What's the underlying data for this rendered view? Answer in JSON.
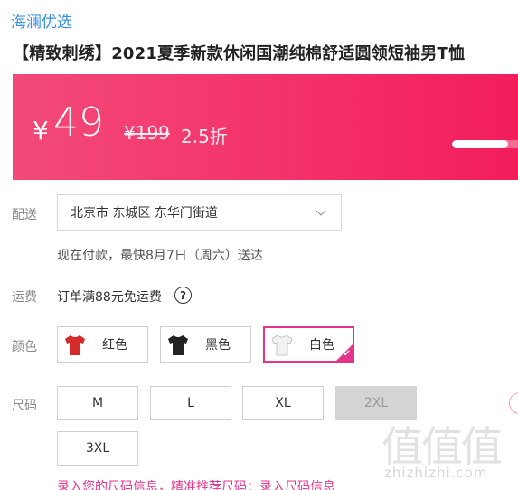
{
  "store": {
    "name": "海澜优选"
  },
  "product": {
    "title": "【精致刺绣】2021夏季新款休闲国潮纯棉舒适圆领短袖男T恤"
  },
  "price": {
    "currency": "¥",
    "current": "49",
    "original": "¥199",
    "discount": "2.5折",
    "progress_fraction": 0.85
  },
  "delivery": {
    "label": "配送",
    "address": "北京市 东城区 东华门街道",
    "time_text": "现在付款，最快8月7日（周六）送达"
  },
  "shipping": {
    "label": "运费",
    "text": "订单满88元免运费",
    "help_glyph": "?"
  },
  "color": {
    "label": "颜色",
    "options": [
      {
        "name": "红色",
        "swatch": "#d42a2a",
        "selected": false
      },
      {
        "name": "黑色",
        "swatch": "#222222",
        "selected": false
      },
      {
        "name": "白色",
        "swatch": "#f2f2f2",
        "selected": true
      }
    ],
    "selected_mark": "✔"
  },
  "size": {
    "label": "尺码",
    "options": [
      {
        "name": "M",
        "available": true
      },
      {
        "name": "L",
        "available": true
      },
      {
        "name": "XL",
        "available": true
      },
      {
        "name": "2XL",
        "available": false
      },
      {
        "name": "3XL",
        "available": true
      }
    ],
    "info_text": "录入您的尺码信息，精准推荐尺码：录入尺码信息"
  },
  "watermark": {
    "logo_text": "值值值",
    "url": "zhizhizhi.com"
  },
  "colors": {
    "accent": "#e4358c",
    "banner": "#f4316a",
    "store_link": "#3a8ee6"
  }
}
